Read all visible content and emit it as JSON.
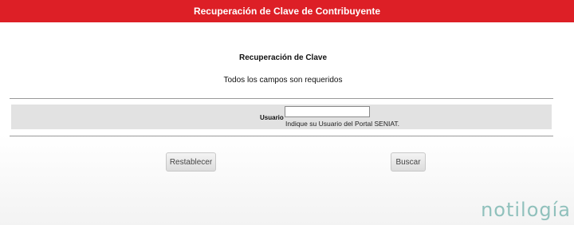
{
  "header": {
    "title": "Recuperación de Clave de Contribuyente"
  },
  "form": {
    "section_title": "Recuperación de Clave",
    "required_note": "Todos los campos son requeridos",
    "usuario_label": "Usuario",
    "usuario_value": "",
    "usuario_hint": "Indique su Usuario del Portal SENIAT."
  },
  "buttons": {
    "reset_label": "Restablecer",
    "search_label": "Buscar"
  },
  "watermark": {
    "text": "notilogía"
  },
  "colors": {
    "header_bg": "#dd1f26",
    "form_row_bg": "#e2e2e2",
    "watermark": "#7fb8b3"
  }
}
